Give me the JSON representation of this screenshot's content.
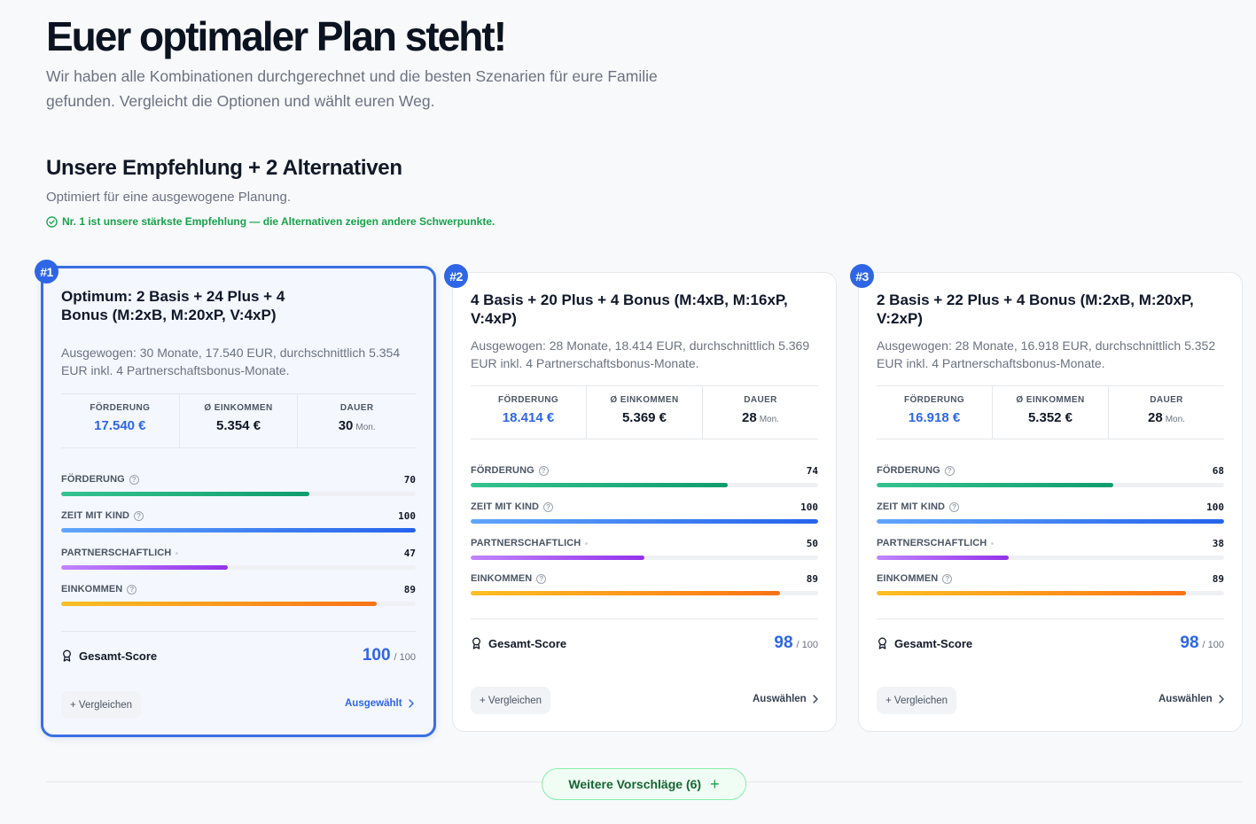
{
  "header": {
    "title": "Euer optimaler Plan steht!",
    "subtitle": "Wir haben alle Kombinationen durchgerechnet und die besten Szenarien für eure Familie gefunden. Vergleicht die Optionen und wählt euren Weg."
  },
  "section": {
    "title": "Unsere Empfehlung + 2 Alternativen",
    "subtitle": "Optimiert für eine ausgewogene Planung.",
    "hint": "Nr. 1 ist unsere stärkste Empfehlung — die Alternativen zeigen andere Schwerpunkte."
  },
  "labels": {
    "stat_funding": "FÖRDERUNG",
    "stat_income": "Ø EINKOMMEN",
    "stat_duration": "DAUER",
    "duration_unit": "Mon.",
    "metric_funding": "FÖRDERUNG",
    "metric_time": "ZEIT MIT KIND",
    "metric_partner": "PARTNERSCHAFTLICH",
    "metric_income": "EINKOMMEN",
    "total_score": "Gesamt-Score",
    "score_max": "/ 100",
    "compare": "+ Vergleichen"
  },
  "plans": [
    {
      "rank": "#1",
      "title": "Optimum: 2 Basis + 24 Plus + 4 Bonus (M:2xB, M:20xP, V:4xP)",
      "description": "Ausgewogen: 30 Monate, 17.540 EUR, durchschnittlich 5.354 EUR inkl. 4 Partnerschaftsbonus-Monate.",
      "funding": "17.540 €",
      "income": "5.354 €",
      "duration": "30",
      "metrics": {
        "funding": 70,
        "time": 100,
        "partner": 47,
        "income": 89
      },
      "score": "100",
      "action": "Ausgewählt",
      "selected": true
    },
    {
      "rank": "#2",
      "title": "4 Basis + 20 Plus + 4 Bonus (M:4xB, M:16xP, V:4xP)",
      "description": "Ausgewogen: 28 Monate, 18.414 EUR, durchschnittlich 5.369 EUR inkl. 4 Partnerschaftsbonus-Monate.",
      "funding": "18.414 €",
      "income": "5.369 €",
      "duration": "28",
      "metrics": {
        "funding": 74,
        "time": 100,
        "partner": 50,
        "income": 89
      },
      "score": "98",
      "action": "Auswählen",
      "selected": false
    },
    {
      "rank": "#3",
      "title": "2 Basis + 22 Plus + 4 Bonus (M:2xB, M:20xP, V:2xP)",
      "description": "Ausgewogen: 28 Monate, 16.918 EUR, durchschnittlich 5.352 EUR inkl. 4 Partnerschaftsbonus-Monate.",
      "funding": "16.918 €",
      "income": "5.352 €",
      "duration": "28",
      "metrics": {
        "funding": 68,
        "time": 100,
        "partner": 38,
        "income": 89
      },
      "score": "98",
      "action": "Auswählen",
      "selected": false
    }
  ],
  "more_button": "Weitere Vorschläge (6)",
  "colors": {
    "accent": "#2e66e6",
    "success": "#16a34a",
    "metric_funding": "#0f9d6e",
    "metric_time": "#2563eb",
    "metric_partner": "#9333ea",
    "metric_income": "#f97316"
  },
  "icons": {
    "hint": "check-circle-icon",
    "score": "award-icon",
    "help": "help-circle-icon",
    "chevron": "chevron-right-icon",
    "plus": "plus-icon"
  }
}
